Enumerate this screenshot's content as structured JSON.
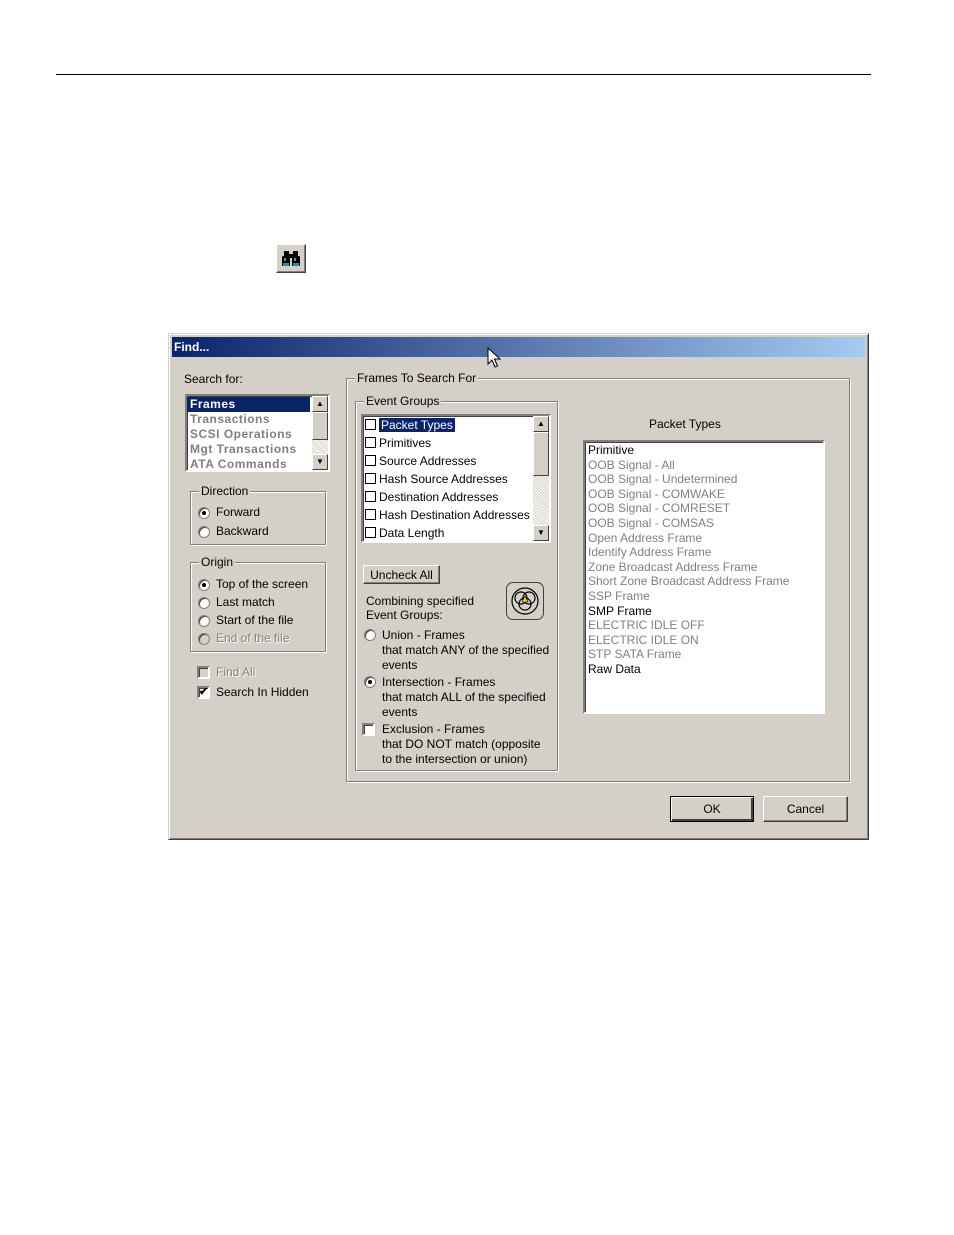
{
  "dialog": {
    "title": "Find...",
    "search_for": {
      "label": "Search for:",
      "items": [
        {
          "label": "Frames",
          "selected": true
        },
        {
          "label": "Transactions",
          "selected": false
        },
        {
          "label": "SCSI Operations",
          "selected": false
        },
        {
          "label": "Mgt Transactions",
          "selected": false
        },
        {
          "label": "ATA Commands",
          "selected": false
        }
      ]
    },
    "direction": {
      "label": "Direction",
      "options": [
        {
          "label": "Forward",
          "selected": true
        },
        {
          "label": "Backward",
          "selected": false
        }
      ]
    },
    "origin": {
      "label": "Origin",
      "options": [
        {
          "label": "Top of the screen",
          "selected": true,
          "enabled": true
        },
        {
          "label": "Last match",
          "selected": false,
          "enabled": true
        },
        {
          "label": "Start of the file",
          "selected": false,
          "enabled": true
        },
        {
          "label": "End of the file",
          "selected": false,
          "enabled": false
        }
      ]
    },
    "find_all": {
      "label": "Find All",
      "checked": false,
      "enabled": false
    },
    "search_in_hidden": {
      "label": "Search In Hidden",
      "checked": true,
      "check_glyph": "✔"
    },
    "frames_to_search": {
      "label": "Frames To Search For",
      "event_groups": {
        "label": "Event Groups",
        "items": [
          {
            "label": "Packet Types",
            "selected": true
          },
          {
            "label": "Primitives",
            "selected": false
          },
          {
            "label": "Source Addresses",
            "selected": false
          },
          {
            "label": "Hash Source Addresses",
            "selected": false
          },
          {
            "label": "Destination Addresses",
            "selected": false
          },
          {
            "label": "Hash Destination Addresses",
            "selected": false
          },
          {
            "label": "Data Length",
            "selected": false
          }
        ],
        "uncheck_all": "Uncheck All",
        "combining_line1": "Combining specified",
        "combining_line2": "Event Groups:",
        "union": {
          "line1": "Union - Frames",
          "line2": "that match ANY of the specified",
          "line3": "events",
          "selected": false
        },
        "intersection": {
          "line1": "Intersection - Frames",
          "line2": "that match ALL of the specified",
          "line3": "events",
          "selected": true
        },
        "exclusion": {
          "line1": "Exclusion - Frames",
          "line2": "that DO NOT match (opposite",
          "line3": "to the intersection or union)",
          "checked": false
        }
      },
      "packet_types": {
        "label": "Packet Types",
        "items": [
          {
            "label": "Primitive",
            "enabled": true
          },
          {
            "label": "OOB Signal - All",
            "enabled": false
          },
          {
            "label": "OOB Signal - Undetermined",
            "enabled": false
          },
          {
            "label": "OOB Signal - COMWAKE",
            "enabled": false
          },
          {
            "label": "OOB Signal - COMRESET",
            "enabled": false
          },
          {
            "label": "OOB Signal - COMSAS",
            "enabled": false
          },
          {
            "label": "Open Address Frame",
            "enabled": false
          },
          {
            "label": "Identify Address Frame",
            "enabled": false
          },
          {
            "label": "Zone Broadcast Address Frame",
            "enabled": false
          },
          {
            "label": "Short Zone Broadcast Address Frame",
            "enabled": false
          },
          {
            "label": "SSP Frame",
            "enabled": false
          },
          {
            "label": "SMP Frame",
            "enabled": true
          },
          {
            "label": "ELECTRIC IDLE OFF",
            "enabled": false
          },
          {
            "label": "ELECTRIC IDLE ON",
            "enabled": false
          },
          {
            "label": "STP SATA Frame",
            "enabled": false
          },
          {
            "label": "Raw Data",
            "enabled": true
          }
        ]
      }
    },
    "ok": "OK",
    "cancel": "Cancel"
  },
  "colors": {
    "face": "#d4d0c8",
    "selection": "#0a246a",
    "disabled_text": "#808080",
    "title_gradient_end": "#a6caf0"
  },
  "icons": {
    "toolbar": "binoculars-icon",
    "venn": "venn-diagram-icon",
    "cursor": "mouse-pointer-icon"
  }
}
